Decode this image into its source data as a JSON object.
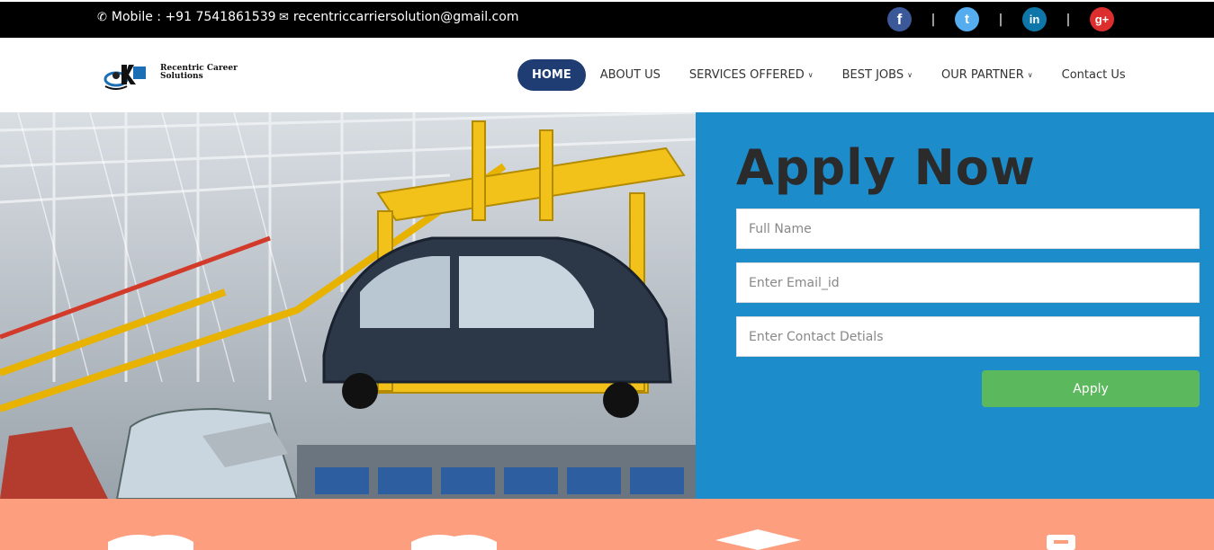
{
  "topbar": {
    "mobile_text": "Mobile : +91 7541861539",
    "email_text": "recentriccarriersolution@gmail.com",
    "mobile_icon": "phone-icon",
    "email_icon": "envelope-icon",
    "social": [
      {
        "name": "facebook-icon",
        "glyph": "f",
        "color": "#3b5998"
      },
      {
        "name": "twitter-icon",
        "glyph": "t",
        "color": "#55acee"
      },
      {
        "name": "linkedin-icon",
        "glyph": "in",
        "color": "#0e76a8"
      },
      {
        "name": "google-plus-icon",
        "glyph": "g+",
        "color": "#dd2e2e"
      }
    ],
    "separator": "|"
  },
  "logo": {
    "text_line1": "Recentric Career",
    "text_line2": "Solutions"
  },
  "nav": {
    "items": [
      {
        "label": "HOME",
        "active": true,
        "dropdown": false
      },
      {
        "label": "ABOUT US",
        "active": false,
        "dropdown": false
      },
      {
        "label": "SERVICES OFFERED",
        "active": false,
        "dropdown": true
      },
      {
        "label": "BEST JOBS",
        "active": false,
        "dropdown": true
      },
      {
        "label": "OUR PARTNER",
        "active": false,
        "dropdown": true
      },
      {
        "label": "Contact Us",
        "active": false,
        "dropdown": false
      }
    ]
  },
  "apply": {
    "title": "Apply Now",
    "full_name_placeholder": "Full Name",
    "email_placeholder": "Enter Email_id",
    "contact_placeholder": "Enter Contact Detials",
    "button_label": "Apply"
  },
  "colors": {
    "topbar": "#000000",
    "nav_active": "#1f3d73",
    "apply_panel": "#1c8ccb",
    "apply_button": "#5cb85c",
    "band": "#fd9f7e"
  }
}
